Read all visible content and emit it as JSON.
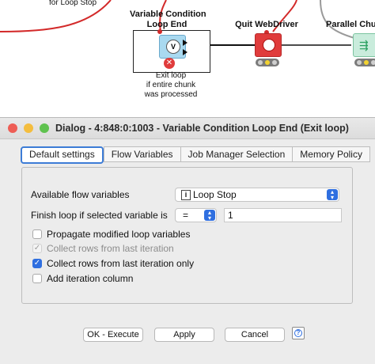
{
  "canvas": {
    "top_left_caption": "for Loop Stop",
    "nodes": [
      {
        "title": "Variable Condition\nLoop End",
        "caption": "Exit loop\nif entire chunk\nwas processed"
      },
      {
        "title": "Quit WebDriver"
      },
      {
        "title": "Parallel Chun"
      }
    ],
    "colors": {
      "wire": "#d32a2a",
      "quit_node": "#e03c3c",
      "parallel_node": "#c9ecdc",
      "loop_node": "#a9d9f0"
    }
  },
  "dialog": {
    "title": "Dialog - 4:848:0:1003 - Variable Condition Loop End (Exit loop)",
    "tabs": [
      "Default settings",
      "Flow Variables",
      "Job Manager Selection",
      "Memory Policy"
    ],
    "active_tab": "Default settings",
    "available_flow_variables_label": "Available flow variables",
    "available_flow_variables_value": "Loop Stop",
    "variable_type_glyph": "i",
    "finish_loop_label": "Finish loop if selected variable is",
    "operator_value": "=",
    "finish_value": "1",
    "checkboxes": [
      {
        "label": "Propagate modified loop variables",
        "checked": false,
        "enabled": true
      },
      {
        "label": "Collect rows from last iteration",
        "checked": true,
        "enabled": false
      },
      {
        "label": "Collect rows from last iteration only",
        "checked": true,
        "enabled": true
      },
      {
        "label": "Add iteration column",
        "checked": false,
        "enabled": true
      }
    ],
    "buttons": {
      "ok_execute": "OK - Execute",
      "apply": "Apply",
      "cancel": "Cancel"
    },
    "colors": {
      "accent": "#2f6fe0",
      "close": "#ee5d55",
      "minimize": "#f4bd3e",
      "maximize": "#5fc24f"
    }
  }
}
